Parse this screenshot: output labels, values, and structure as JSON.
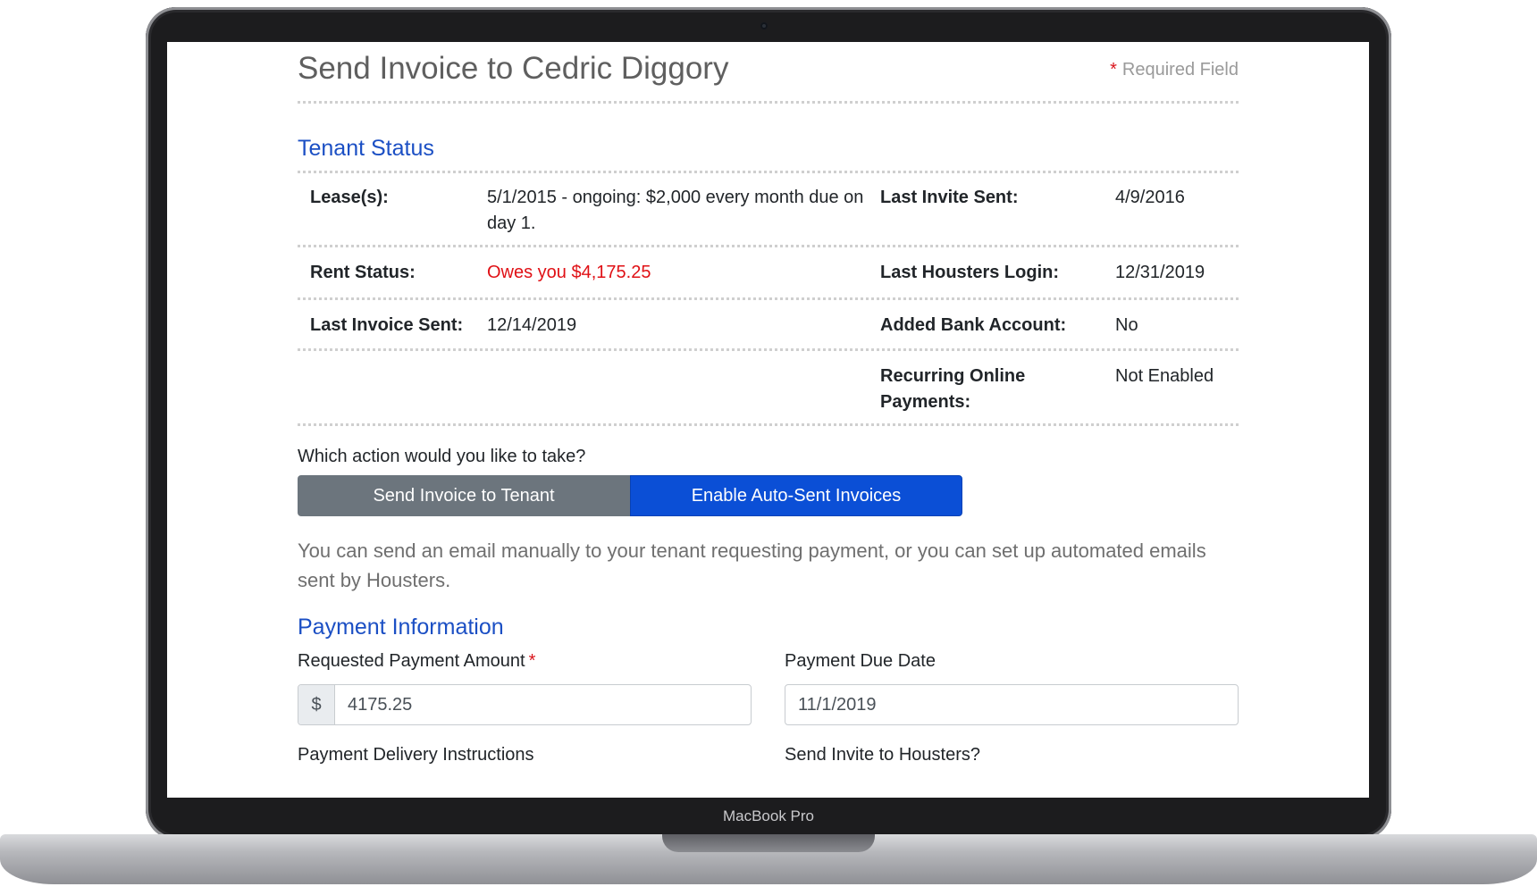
{
  "device": {
    "brand_label": "MacBook Pro"
  },
  "header": {
    "title": "Send Invoice to Cedric Diggory",
    "required_star": "*",
    "required_label": "Required Field"
  },
  "tenant_status": {
    "section_title": "Tenant Status",
    "rows": [
      {
        "label1": "Lease(s):",
        "value1": "5/1/2015 - ongoing: $2,000 every month due on day 1.",
        "label2": "Last Invite Sent:",
        "value2": "4/9/2016"
      },
      {
        "label1": "Rent Status:",
        "value1": "Owes you $4,175.25",
        "label2": "Last Housters Login:",
        "value2": "12/31/2019"
      },
      {
        "label1": "Last Invoice Sent:",
        "value1": "12/14/2019",
        "label2": "Added Bank Account:",
        "value2": "No"
      },
      {
        "label1": "",
        "value1": "",
        "label2": "Recurring Online Payments:",
        "value2": "Not Enabled"
      }
    ]
  },
  "action": {
    "question": "Which action would you like to take?",
    "send_invoice_label": "Send Invoice to Tenant",
    "auto_invoice_label": "Enable Auto-Sent Invoices",
    "help_text": "You can send an email manually to your tenant requesting payment, or you can set up automated emails sent by Housters."
  },
  "payment": {
    "section_title": "Payment Information",
    "amount_label": "Requested Payment Amount",
    "amount_star": "*",
    "currency_symbol": "$",
    "amount_value": "4175.25",
    "due_date_label": "Payment Due Date",
    "due_date_value": "11/1/2019",
    "delivery_label": "Payment Delivery Instructions",
    "invite_label": "Send Invite to Housters?"
  },
  "colors": {
    "accent_blue": "#1b4fc4",
    "primary_button": "#0b4fd6",
    "secondary_button": "#6c757d",
    "alert_red": "#e01015"
  }
}
